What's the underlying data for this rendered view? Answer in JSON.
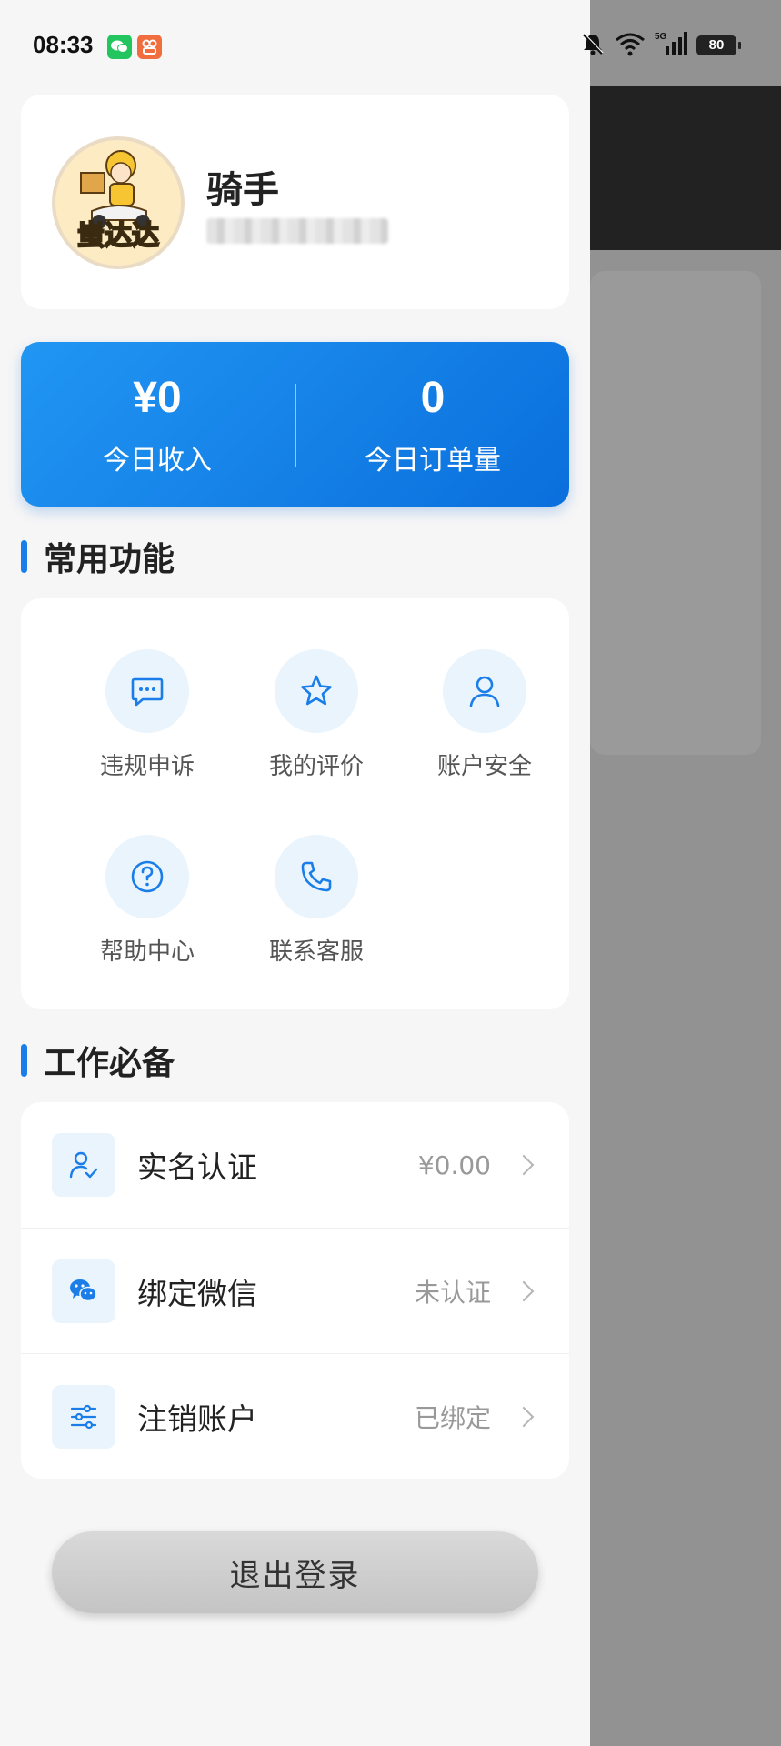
{
  "status_bar": {
    "time": "08:33",
    "battery": "80",
    "network": "5G"
  },
  "profile": {
    "name": "骑手",
    "avatar_text": "蚩达达"
  },
  "stats": {
    "income_value": "¥0",
    "income_label": "今日收入",
    "orders_value": "0",
    "orders_label": "今日订单量"
  },
  "functions": {
    "title": "常用功能",
    "items": [
      {
        "label": "违规申诉",
        "icon": "message-icon"
      },
      {
        "label": "我的评价",
        "icon": "star-icon"
      },
      {
        "label": "账户安全",
        "icon": "user-icon"
      },
      {
        "label": "帮助中心",
        "icon": "help-icon"
      },
      {
        "label": "联系客服",
        "icon": "phone-icon"
      }
    ]
  },
  "work": {
    "title": "工作必备",
    "rows": [
      {
        "label": "实名认证",
        "value": "¥0.00",
        "icon": "user-check-icon"
      },
      {
        "label": "绑定微信",
        "value": "未认证",
        "icon": "wechat-icon"
      },
      {
        "label": "注销账户",
        "value": "已绑定",
        "icon": "sliders-icon"
      }
    ]
  },
  "logout_label": "退出登录",
  "colors": {
    "accent": "#1a7de8",
    "stats_gradient_start": "#2196f3",
    "stats_gradient_end": "#0a6fdc",
    "icon_bg": "#e9f4fd",
    "drawer_bg": "#f6f6f6",
    "overlay": "#929292"
  }
}
